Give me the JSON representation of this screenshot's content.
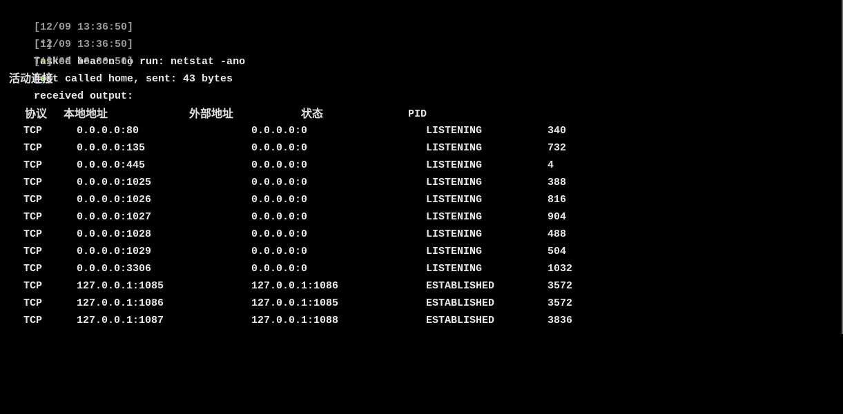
{
  "log": [
    {
      "timestamp": "[12/09 13:36:50]",
      "marker_open": "[",
      "marker": "*",
      "marker_close": "]",
      "message": "Tasked beacon to run: netstat -ano"
    },
    {
      "timestamp": "[12/09 13:36:50]",
      "marker_open": "[",
      "marker": "+",
      "marker_close": "]",
      "message": "host called home, sent: 43 bytes"
    },
    {
      "timestamp": "[12/09 13:36:50]",
      "marker_open": "[",
      "marker": "+",
      "marker_close": "]",
      "message": "received output:"
    }
  ],
  "section_title": "活动连接",
  "headers": {
    "proto": "协议",
    "local": "本地地址",
    "foreign": "外部地址",
    "state": "状态",
    "pid": "PID"
  },
  "rows": [
    {
      "proto": "TCP",
      "local": "0.0.0.0:80",
      "foreign": "0.0.0.0:0",
      "state": "LISTENING",
      "pid": "340"
    },
    {
      "proto": "TCP",
      "local": "0.0.0.0:135",
      "foreign": "0.0.0.0:0",
      "state": "LISTENING",
      "pid": "732"
    },
    {
      "proto": "TCP",
      "local": "0.0.0.0:445",
      "foreign": "0.0.0.0:0",
      "state": "LISTENING",
      "pid": "4"
    },
    {
      "proto": "TCP",
      "local": "0.0.0.0:1025",
      "foreign": "0.0.0.0:0",
      "state": "LISTENING",
      "pid": "388"
    },
    {
      "proto": "TCP",
      "local": "0.0.0.0:1026",
      "foreign": "0.0.0.0:0",
      "state": "LISTENING",
      "pid": "816"
    },
    {
      "proto": "TCP",
      "local": "0.0.0.0:1027",
      "foreign": "0.0.0.0:0",
      "state": "LISTENING",
      "pid": "904"
    },
    {
      "proto": "TCP",
      "local": "0.0.0.0:1028",
      "foreign": "0.0.0.0:0",
      "state": "LISTENING",
      "pid": "488"
    },
    {
      "proto": "TCP",
      "local": "0.0.0.0:1029",
      "foreign": "0.0.0.0:0",
      "state": "LISTENING",
      "pid": "504"
    },
    {
      "proto": "TCP",
      "local": "0.0.0.0:3306",
      "foreign": "0.0.0.0:0",
      "state": "LISTENING",
      "pid": "1032"
    },
    {
      "proto": "TCP",
      "local": "127.0.0.1:1085",
      "foreign": "127.0.0.1:1086",
      "state": "ESTABLISHED",
      "pid": "3572"
    },
    {
      "proto": "TCP",
      "local": "127.0.0.1:1086",
      "foreign": "127.0.0.1:1085",
      "state": "ESTABLISHED",
      "pid": "3572"
    },
    {
      "proto": "TCP",
      "local": "127.0.0.1:1087",
      "foreign": "127.0.0.1:1088",
      "state": "ESTABLISHED",
      "pid": "3836"
    }
  ],
  "colors": {
    "background": "#000000",
    "text": "#e8e8e8",
    "timestamp": "#9a9a9a",
    "info_marker": "#6fa8ff",
    "success_marker": "#7fe03b"
  }
}
